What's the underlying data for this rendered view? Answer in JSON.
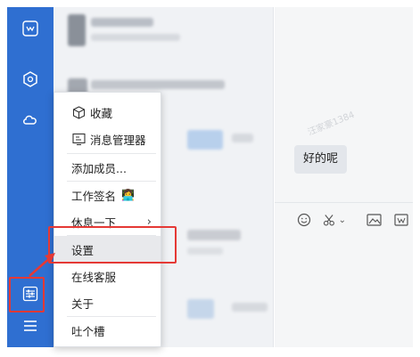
{
  "rail": {
    "icons": [
      "logo-icon",
      "cube-icon",
      "cloud-icon",
      "settings-sliders-icon",
      "hamburger-icon"
    ]
  },
  "menu": {
    "items": [
      {
        "label": "收藏",
        "icon": "cube-outline-icon"
      },
      {
        "label": "消息管理器",
        "icon": "message-manager-icon"
      },
      {
        "label": "添加成员..."
      },
      {
        "label": "工作签名",
        "emoji": "👩‍💻"
      },
      {
        "label": "休息一下",
        "chevron": "›"
      },
      {
        "label": "设置"
      },
      {
        "label": "在线客服"
      },
      {
        "label": "关于"
      },
      {
        "label": "吐个槽"
      }
    ],
    "highlighted_index": 5
  },
  "chat": {
    "watermark": "汪家豪1384",
    "message": "好的呢"
  },
  "toolbar": {
    "icons": [
      "emoji-icon",
      "scissors-icon",
      "image-icon",
      "file-icon"
    ],
    "dropdown": "⌄"
  },
  "colors": {
    "rail_bg": "#2f6fd1",
    "highlight_box": "#e53935",
    "menu_hover": "#e8e9ec"
  }
}
